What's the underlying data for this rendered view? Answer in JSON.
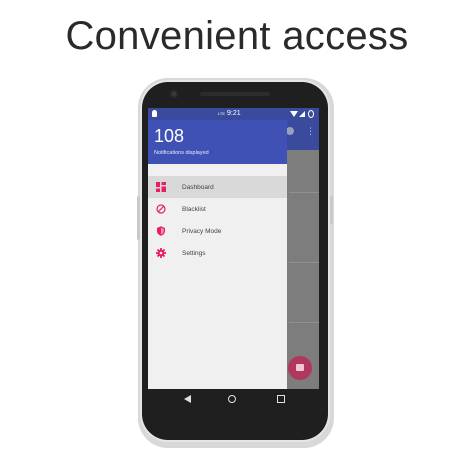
{
  "headline": "Convenient access",
  "status_bar": {
    "network": "LTE",
    "time": "9:21"
  },
  "drawer": {
    "notification_count": "108",
    "notification_label": "Notifications displayed",
    "items": [
      {
        "label": "Dashboard",
        "icon": "dashboard-icon",
        "active": true
      },
      {
        "label": "Blacklist",
        "icon": "block-icon",
        "active": false
      },
      {
        "label": "Privacy Mode",
        "icon": "shield-icon",
        "active": false
      },
      {
        "label": "Settings",
        "icon": "gear-icon",
        "active": false
      }
    ]
  },
  "colors": {
    "primary": "#3f51b5",
    "accent": "#e91e63",
    "fab": "#b0385e"
  },
  "navigation": [
    "back-icon",
    "home-icon",
    "recents-icon"
  ]
}
